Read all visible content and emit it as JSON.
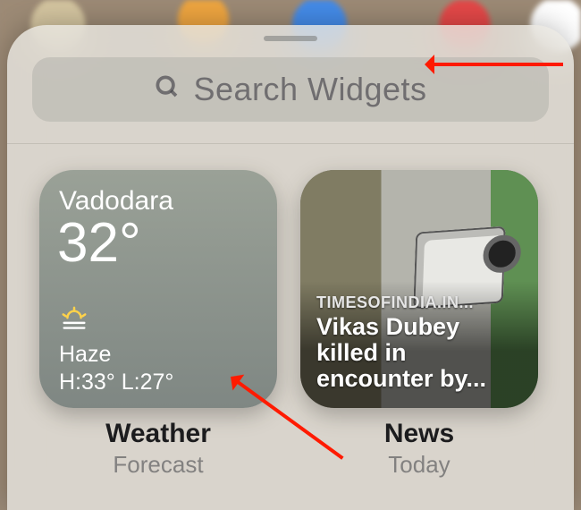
{
  "search": {
    "placeholder": "Search Widgets"
  },
  "widgets": [
    {
      "kind": "weather",
      "app_label": "Weather",
      "sub_label": "Forecast",
      "city": "Vadodara",
      "temperature": "32°",
      "condition_icon": "haze-icon",
      "condition": "Haze",
      "hi_lo": "H:33° L:27°"
    },
    {
      "kind": "news",
      "app_label": "News",
      "sub_label": "Today",
      "source": "TIMESOFINDIA.IN...",
      "headline": "Vikas Dubey killed in encounter by..."
    }
  ],
  "annotations": {
    "arrow_search": "red-arrow-to-search",
    "arrow_widget": "red-arrow-to-weather-widget"
  }
}
